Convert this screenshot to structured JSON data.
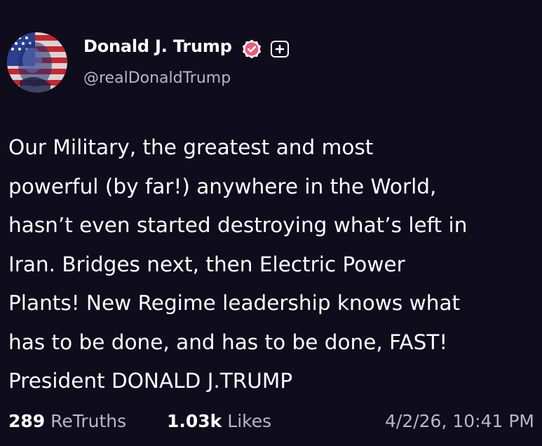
{
  "author": {
    "display_name": "Donald J. Trump",
    "handle": "@realDonaldTrump",
    "verified_icon": "verified-badge-icon",
    "extra_icon": "plus-icon",
    "verified_color": "#ea5b77"
  },
  "post": {
    "lines": [
      "Our Military, the greatest and most",
      "powerful (by far!) anywhere in the World,",
      "hasn’t even started destroying what’s left in",
      "Iran. Bridges next, then Electric Power",
      "Plants! New Regime leadership knows what",
      "has to be done, and has to be done, FAST!",
      "President DONALD J.TRUMP"
    ]
  },
  "stats": {
    "retruths_count": "289",
    "retruths_label": "ReTruths",
    "likes_count": "1.03k",
    "likes_label": "Likes",
    "timestamp": "4/2/26, 10:41 PM"
  },
  "colors": {
    "background": "#0f0c1c",
    "text_primary": "#ffffff",
    "text_secondary": "#b9b6c6"
  }
}
